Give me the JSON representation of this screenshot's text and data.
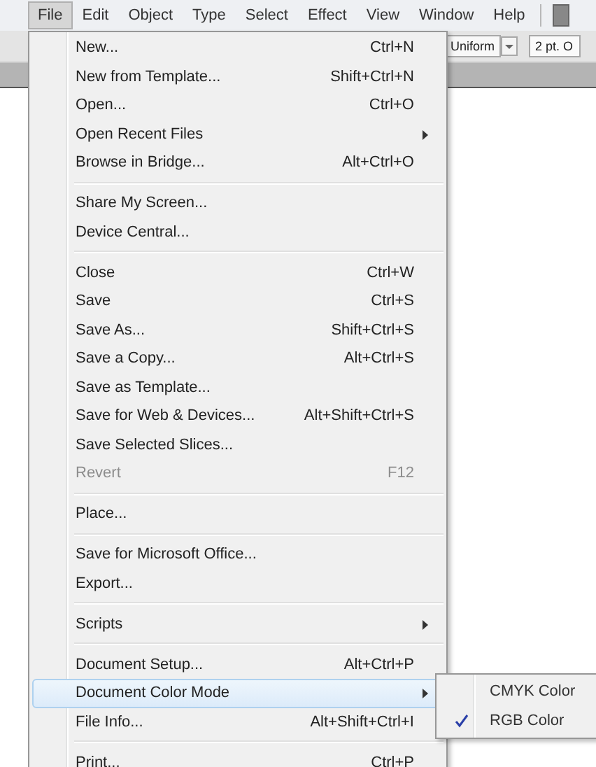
{
  "menubar": [
    {
      "label": "File",
      "selected": true
    },
    {
      "label": "Edit",
      "selected": false
    },
    {
      "label": "Object",
      "selected": false
    },
    {
      "label": "Type",
      "selected": false
    },
    {
      "label": "Select",
      "selected": false
    },
    {
      "label": "Effect",
      "selected": false
    },
    {
      "label": "View",
      "selected": false
    },
    {
      "label": "Window",
      "selected": false
    },
    {
      "label": "Help",
      "selected": false
    }
  ],
  "toolbar": {
    "stroke_profile": "Uniform",
    "stroke_weight": "2 pt. O"
  },
  "file_menu": [
    {
      "items": [
        {
          "label": "New...",
          "shortcut": "Ctrl+N",
          "submenu": false,
          "disabled": false,
          "highlighted": false
        },
        {
          "label": "New from Template...",
          "shortcut": "Shift+Ctrl+N",
          "submenu": false,
          "disabled": false,
          "highlighted": false
        },
        {
          "label": "Open...",
          "shortcut": "Ctrl+O",
          "submenu": false,
          "disabled": false,
          "highlighted": false
        },
        {
          "label": "Open Recent Files",
          "submenu": true,
          "disabled": false,
          "highlighted": false
        },
        {
          "label": "Browse in Bridge...",
          "shortcut": "Alt+Ctrl+O",
          "submenu": false,
          "disabled": false,
          "highlighted": false
        }
      ]
    },
    {
      "items": [
        {
          "label": "Share My Screen...",
          "submenu": false,
          "disabled": false,
          "highlighted": false
        },
        {
          "label": "Device Central...",
          "submenu": false,
          "disabled": false,
          "highlighted": false
        }
      ]
    },
    {
      "items": [
        {
          "label": "Close",
          "shortcut": "Ctrl+W",
          "submenu": false,
          "disabled": false,
          "highlighted": false
        },
        {
          "label": "Save",
          "shortcut": "Ctrl+S",
          "submenu": false,
          "disabled": false,
          "highlighted": false
        },
        {
          "label": "Save As...",
          "shortcut": "Shift+Ctrl+S",
          "submenu": false,
          "disabled": false,
          "highlighted": false
        },
        {
          "label": "Save a Copy...",
          "shortcut": "Alt+Ctrl+S",
          "submenu": false,
          "disabled": false,
          "highlighted": false
        },
        {
          "label": "Save as Template...",
          "submenu": false,
          "disabled": false,
          "highlighted": false
        },
        {
          "label": "Save for Web & Devices...",
          "shortcut": "Alt+Shift+Ctrl+S",
          "submenu": false,
          "disabled": false,
          "highlighted": false
        },
        {
          "label": "Save Selected Slices...",
          "submenu": false,
          "disabled": false,
          "highlighted": false
        },
        {
          "label": "Revert",
          "shortcut": "F12",
          "submenu": false,
          "disabled": true,
          "highlighted": false
        }
      ]
    },
    {
      "items": [
        {
          "label": "Place...",
          "submenu": false,
          "disabled": false,
          "highlighted": false
        }
      ]
    },
    {
      "items": [
        {
          "label": "Save for Microsoft Office...",
          "submenu": false,
          "disabled": false,
          "highlighted": false
        },
        {
          "label": "Export...",
          "submenu": false,
          "disabled": false,
          "highlighted": false
        }
      ]
    },
    {
      "items": [
        {
          "label": "Scripts",
          "submenu": true,
          "disabled": false,
          "highlighted": false
        }
      ]
    },
    {
      "items": [
        {
          "label": "Document Setup...",
          "shortcut": "Alt+Ctrl+P",
          "submenu": false,
          "disabled": false,
          "highlighted": false
        },
        {
          "label": "Document Color Mode",
          "submenu": true,
          "disabled": false,
          "highlighted": true
        },
        {
          "label": "File Info...",
          "shortcut": "Alt+Shift+Ctrl+I",
          "submenu": false,
          "disabled": false,
          "highlighted": false
        }
      ]
    },
    {
      "items": [
        {
          "label": "Print...",
          "shortcut": "Ctrl+P",
          "submenu": false,
          "disabled": false,
          "highlighted": false
        }
      ]
    }
  ],
  "color_mode_submenu": [
    {
      "label": "CMYK Color",
      "checked": false
    },
    {
      "label": "RGB Color",
      "checked": true
    }
  ]
}
